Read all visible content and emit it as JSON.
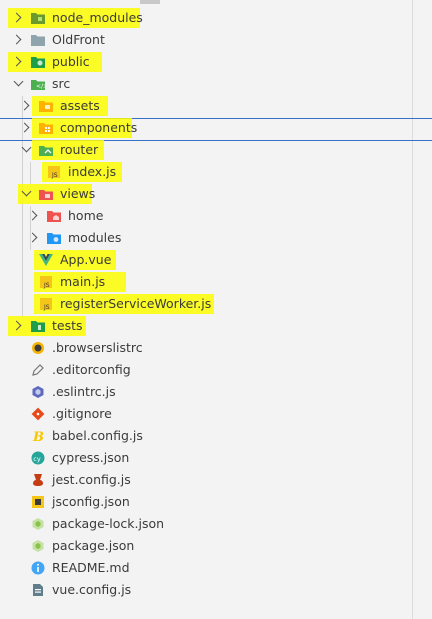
{
  "explorer": {
    "items": [
      {
        "label": "node_modules",
        "icon": "folder-node-icon",
        "expandable": true,
        "expanded": false,
        "highlighted": true,
        "color": "#8bc34a"
      },
      {
        "label": "OldFront",
        "icon": "folder-icon",
        "expandable": true,
        "expanded": false,
        "highlighted": false,
        "color": "#90a4ae"
      },
      {
        "label": "public",
        "icon": "folder-public-icon",
        "expandable": true,
        "expanded": false,
        "highlighted": true,
        "color": "#1f9e4a"
      },
      {
        "label": "src",
        "icon": "folder-src-icon",
        "expandable": true,
        "expanded": true,
        "highlighted": false,
        "color": "#4caf50"
      },
      {
        "label": "assets",
        "icon": "folder-assets-icon",
        "expandable": true,
        "expanded": false,
        "highlighted": true,
        "color": "#ffb300"
      },
      {
        "label": "components",
        "icon": "folder-components-icon",
        "expandable": true,
        "expanded": false,
        "highlighted": true,
        "color": "#ffb300"
      },
      {
        "label": "router",
        "icon": "folder-router-icon",
        "expandable": true,
        "expanded": true,
        "highlighted": true,
        "color": "#4caf50"
      },
      {
        "label": "index.js",
        "icon": "javascript-file-icon",
        "expandable": false,
        "highlighted": true,
        "color": "#f5c518"
      },
      {
        "label": "views",
        "icon": "folder-views-icon",
        "expandable": true,
        "expanded": true,
        "highlighted": true,
        "color": "#ef5350"
      },
      {
        "label": "home",
        "icon": "folder-home-icon",
        "expandable": true,
        "expanded": false,
        "highlighted": false,
        "color": "#ef5350"
      },
      {
        "label": "modules",
        "icon": "folder-modules-icon",
        "expandable": true,
        "expanded": false,
        "highlighted": false,
        "color": "#2196f3"
      },
      {
        "label": "App.vue",
        "icon": "vue-file-icon",
        "expandable": false,
        "highlighted": true,
        "color": "#41b883"
      },
      {
        "label": "main.js",
        "icon": "javascript-file-icon",
        "expandable": false,
        "highlighted": true,
        "color": "#f5c518"
      },
      {
        "label": "registerServiceWorker.js",
        "icon": "javascript-file-icon",
        "expandable": false,
        "highlighted": true,
        "color": "#f5c518"
      },
      {
        "label": "tests",
        "icon": "folder-tests-icon",
        "expandable": true,
        "expanded": false,
        "highlighted": true,
        "color": "#1f9e4a"
      },
      {
        "label": ".browserslistrc",
        "icon": "browserslist-file-icon",
        "expandable": false,
        "highlighted": false,
        "color": "#f5b400"
      },
      {
        "label": ".editorconfig",
        "icon": "editorconfig-file-icon",
        "expandable": false,
        "highlighted": false,
        "color": "#777777"
      },
      {
        "label": ".eslintrc.js",
        "icon": "eslint-file-icon",
        "expandable": false,
        "highlighted": false,
        "color": "#5c6bc0"
      },
      {
        "label": ".gitignore",
        "icon": "git-file-icon",
        "expandable": false,
        "highlighted": false,
        "color": "#e64a19"
      },
      {
        "label": "babel.config.js",
        "icon": "babel-file-icon",
        "expandable": false,
        "highlighted": false,
        "color": "#f9c700"
      },
      {
        "label": "cypress.json",
        "icon": "cypress-file-icon",
        "expandable": false,
        "highlighted": false,
        "color": "#26a69a"
      },
      {
        "label": "jest.config.js",
        "icon": "jest-file-icon",
        "expandable": false,
        "highlighted": false,
        "color": "#c63d14"
      },
      {
        "label": "jsconfig.json",
        "icon": "jsconfig-file-icon",
        "expandable": false,
        "highlighted": false,
        "color": "#f5c518"
      },
      {
        "label": "package-lock.json",
        "icon": "npm-lock-file-icon",
        "expandable": false,
        "highlighted": false,
        "color": "#8bc34a"
      },
      {
        "label": "package.json",
        "icon": "npm-file-icon",
        "expandable": false,
        "highlighted": false,
        "color": "#8bc34a"
      },
      {
        "label": "README.md",
        "icon": "info-file-icon",
        "expandable": false,
        "highlighted": false,
        "color": "#42a5f5"
      },
      {
        "label": "vue.config.js",
        "icon": "vue-config-file-icon",
        "expandable": false,
        "highlighted": false,
        "color": "#607d8b"
      }
    ]
  }
}
